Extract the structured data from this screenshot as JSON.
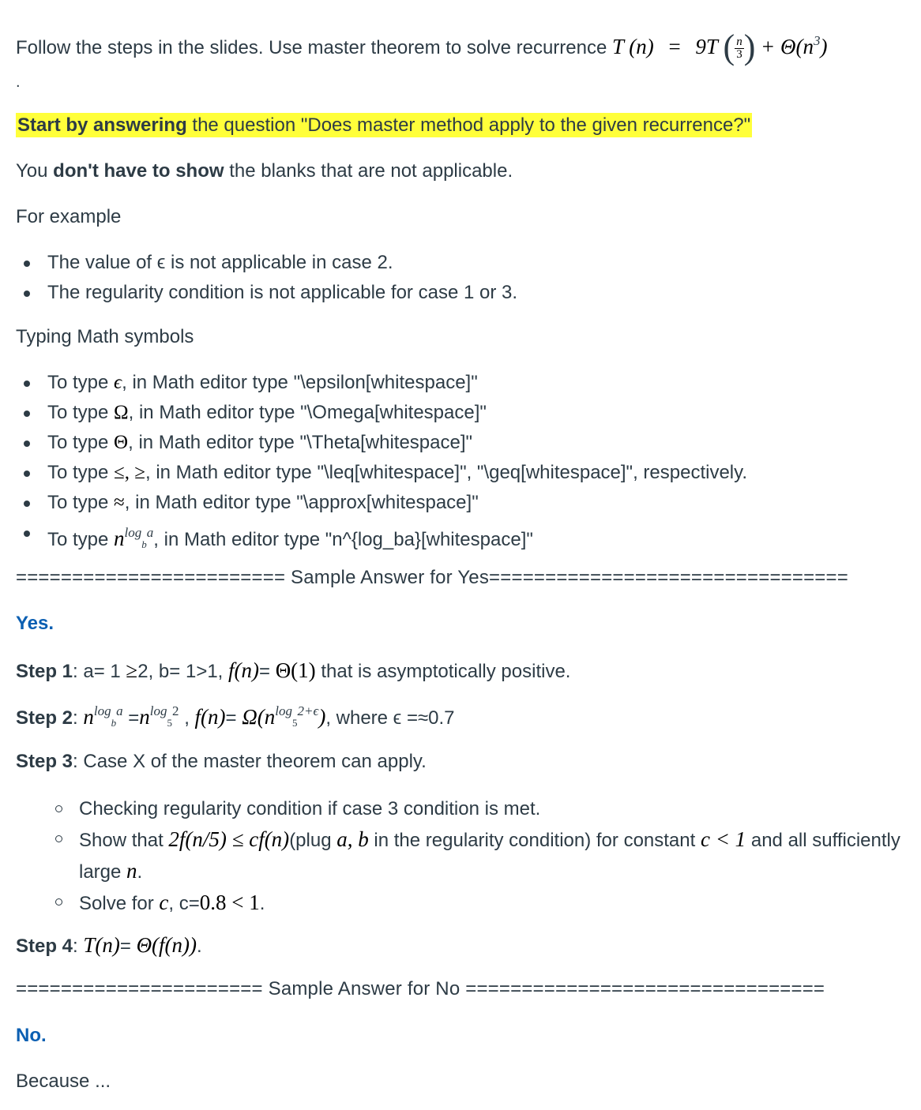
{
  "intro": {
    "text": "Follow the steps in the slides. Use master theorem to solve recurrence",
    "recurrence_lhs": "T (n)",
    "equals": "=",
    "coef": "9T",
    "frac_num": "n",
    "frac_den": "3",
    "plus": "+ Θ(n",
    "exp": "3",
    "close": ")",
    "dot": "."
  },
  "highlight": {
    "bold": "Start by answering",
    "rest": " the question \"Does master method apply to the given recurrence?\""
  },
  "note": {
    "pre": "You ",
    "bold": "don't have to show",
    "post": " the blanks that are not applicable."
  },
  "example_heading": "For example",
  "examples": [
    "The value of ϵ is not applicable in case 2.",
    "The regularity condition is not applicable for case 1 or 3."
  ],
  "symbols_heading": "Typing Math symbols",
  "symbols": [
    {
      "pre": "To type ",
      "sym": "ϵ",
      "post": ", in Math editor type \"\\epsilon[whitespace]\""
    },
    {
      "pre": "To type ",
      "sym": "Ω",
      "post": ", in Math editor type \"\\Omega[whitespace]\""
    },
    {
      "pre": "To type ",
      "sym": "Θ",
      "post": ", in Math editor type \"\\Theta[whitespace]\""
    },
    {
      "pre": "To type ",
      "sym": "≤, ≥",
      "post": ", in Math editor type \"\\leq[whitespace]\", \"\\geq[whitespace]\", respectively."
    },
    {
      "pre": "To type ",
      "sym": "≈",
      "post": ", in Math editor type \"\\approx[whitespace]\""
    }
  ],
  "symbol_log": {
    "pre": "To type ",
    "base": "n",
    "exp": "log",
    "expsub": "b",
    "expend": "a",
    "post": ", in Math editor type \"n^{log_ba}[whitespace]\""
  },
  "sep_yes": "======================== Sample Answer for Yes================================",
  "yes": "Yes.",
  "step1": {
    "label": "Step 1",
    "text1": ": a= 1 ",
    "geq": "≥",
    "text2": "2, b= 1>1, ",
    "f": "f(n)",
    "eq": "= ",
    "theta": "Θ(1)",
    "text3": " that is asymptotically positive."
  },
  "step2": {
    "label": "Step 2",
    "n1": "n",
    "e1": "log",
    "e1sub": "b",
    "e1end": "a",
    "mid": " =",
    "n2": "n",
    "e2": "log",
    "e2sub": "5",
    "e2end": "2",
    "comma": " , ",
    "f": "f(n)",
    "eq": "= ",
    "omega": "Ω(n",
    "e3": "log",
    "e3sub": "5",
    "e3end": "2+ϵ",
    "close": ")",
    "where": ", where ϵ =≈0.7"
  },
  "step3": {
    "label": "Step 3",
    "text": ": Case X of the master theorem can apply."
  },
  "step3_items": {
    "item1": "Checking regularity condition if case 3 condition is met.",
    "item2_pre": "Show that ",
    "item2_math": "2f(n/5) ≤ cf(n)",
    "item2_mid": "(plug ",
    "item2_ab": "a, b",
    "item2_post": " in the regularity condition) for constant ",
    "item2_c": "c < 1",
    "item2_end": " and all sufficiently large ",
    "item2_n": "n",
    "item2_dot": ".",
    "item3_pre": "Solve for ",
    "item3_c": "c",
    "item3_mid": ", c=",
    "item3_val": "0.8 < 1",
    "item3_dot": "."
  },
  "step4": {
    "label": "Step 4",
    "colon": ": ",
    "t": "T(n)",
    "eq": "= ",
    "result": "Θ(f(n))",
    "dot": "."
  },
  "sep_no": "====================== Sample Answer for No ================================",
  "no": "No.",
  "because": "Because ..."
}
